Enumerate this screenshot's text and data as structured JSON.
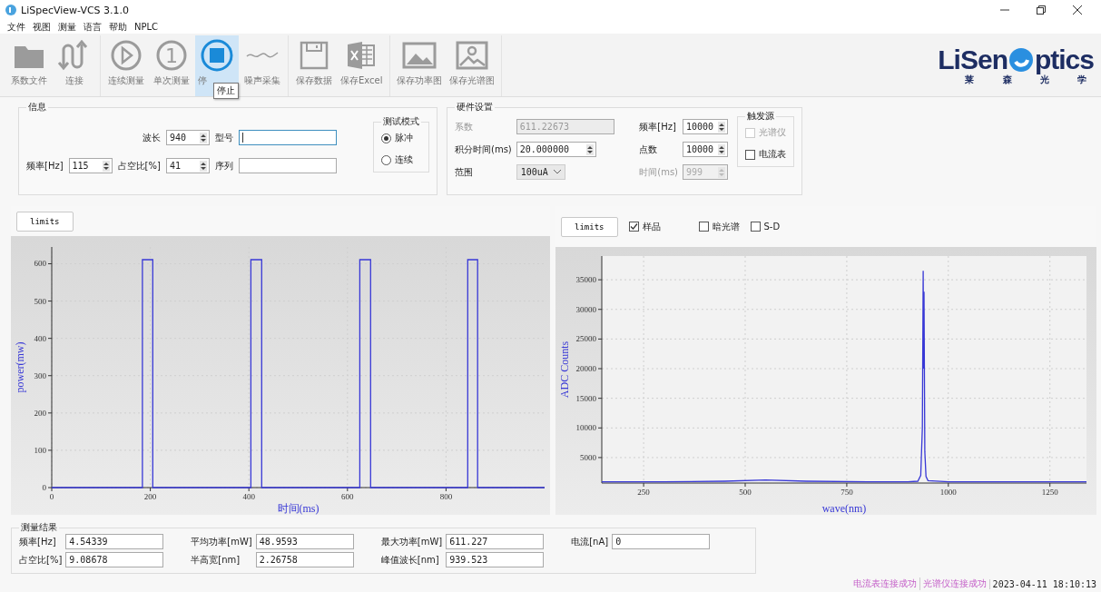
{
  "window": {
    "title": "LiSpecView-VCS 3.1.0"
  },
  "menu": [
    "文件",
    "视图",
    "测量",
    "语言",
    "帮助",
    "NPLC"
  ],
  "toolbar": {
    "groups": [
      [
        {
          "kind": "folder",
          "label": "系数文件",
          "selected": false
        },
        {
          "kind": "loop",
          "label": "连接",
          "selected": false
        }
      ],
      [
        {
          "kind": "play",
          "label": "连续测量",
          "selected": false
        },
        {
          "kind": "one",
          "glyph": "1",
          "label": "单次测量",
          "selected": false
        },
        {
          "kind": "stop",
          "label": "停",
          "selected": true,
          "tooltip": "停止"
        },
        {
          "kind": "wave",
          "label": "噪声采集",
          "selected": false
        }
      ],
      [
        {
          "kind": "save",
          "label": "保存数据",
          "selected": false
        },
        {
          "kind": "excel",
          "label": "保存Excel",
          "selected": false
        }
      ],
      [
        {
          "kind": "image",
          "label": "保存功率图",
          "selected": false
        },
        {
          "kind": "photo",
          "label": "保存光谱图",
          "selected": false
        }
      ]
    ]
  },
  "logo": {
    "left": "LiSen",
    "right": "ptics",
    "subtitle": [
      "莱",
      "森",
      "光",
      "学"
    ]
  },
  "info": {
    "title": "信息",
    "rows": [
      [
        "",
        {
          "kind": "spin",
          "label": "波长",
          "value": "940"
        },
        {
          "kind": "field",
          "label": "型号",
          "focused": true
        }
      ],
      [
        {
          "kind": "spin",
          "label": "频率[Hz]",
          "value": "115"
        },
        {
          "kind": "spin",
          "label": "占空比[%]",
          "value": "41"
        },
        {
          "kind": "field",
          "label": "序列",
          "focused": false
        }
      ]
    ],
    "mode": {
      "title": "测试模式",
      "options": [
        {
          "label": "脉冲",
          "selected": true
        },
        {
          "label": "连续",
          "selected": false
        }
      ]
    }
  },
  "hardware": {
    "title": "硬件设置",
    "left": [
      {
        "kind": "text",
        "label": "系数",
        "value": "611.22673",
        "disabled": true
      },
      {
        "kind": "spin",
        "label": "积分时间(ms)",
        "value": "20.000000",
        "disabled": false
      },
      {
        "kind": "combo",
        "label": "范围",
        "value": "100uA",
        "disabled": false
      }
    ],
    "right": [
      {
        "kind": "spin",
        "label": "频率[Hz]",
        "value": "10000",
        "disabled": false
      },
      {
        "kind": "spin",
        "label": "点数",
        "value": "10000",
        "disabled": false
      },
      {
        "kind": "spin",
        "label": "时间(ms)",
        "value": "999",
        "disabled": true
      }
    ],
    "trigger": {
      "title": "触发源",
      "options": [
        {
          "label": "光谱仪",
          "checked": false,
          "disabled": true
        },
        {
          "label": "电流表",
          "checked": false,
          "disabled": false
        }
      ]
    }
  },
  "power_chart": {
    "button": "limits",
    "chart_data": {
      "type": "line",
      "grid": true,
      "xlabel": "时间(ms)",
      "ylabel": "power(mw)",
      "xlim": [
        0,
        1000
      ],
      "ylim": [
        0,
        645
      ],
      "xticks": [
        0,
        200,
        400,
        600,
        800
      ],
      "yticks": [
        0,
        100,
        200,
        300,
        400,
        500,
        600
      ],
      "x": [
        0,
        184,
        184,
        205,
        205,
        404,
        404,
        426,
        426,
        625,
        625,
        647,
        647,
        844,
        844,
        864,
        864,
        1000
      ],
      "series": [
        {
          "values": [
            0,
            0,
            611,
            611,
            0,
            0,
            611,
            611,
            0,
            0,
            611,
            611,
            0,
            0,
            611,
            611,
            0,
            0
          ]
        }
      ]
    }
  },
  "spectrum_chart": {
    "button": "limits",
    "checks": [
      {
        "label": "样品",
        "checked": true
      },
      {
        "label": "暗光谱",
        "checked": false
      },
      {
        "label": "S-D",
        "checked": false
      }
    ],
    "chart_data": {
      "type": "line",
      "grid": true,
      "xlabel": "wave(nm)",
      "ylabel": "ADC Counts",
      "xlim": [
        147,
        1340
      ],
      "ylim": [
        700,
        39000
      ],
      "xticks": [
        250,
        500,
        750,
        1000,
        1250
      ],
      "yticks": [
        5000,
        10000,
        15000,
        20000,
        25000,
        30000,
        35000
      ],
      "x": [
        147,
        300,
        450,
        550,
        650,
        800,
        900,
        925,
        932,
        936,
        938,
        939,
        940,
        942,
        945,
        950,
        1000,
        1340
      ],
      "series": [
        {
          "values": [
            900,
            900,
            1000,
            1200,
            1000,
            900,
            900,
            1000,
            2000,
            10000,
            36500,
            20000,
            33000,
            6000,
            1800,
            1100,
            900,
            900
          ]
        }
      ]
    }
  },
  "results": {
    "title": "测量结果",
    "columns": [
      [
        {
          "label": "频率[Hz]",
          "value": "4.54339"
        },
        {
          "label": "占空比[%]",
          "value": "9.08678"
        }
      ],
      [
        {
          "label": "平均功率[mW]",
          "value": "48.9593"
        },
        {
          "label": "半高宽[nm]",
          "value": "2.26758"
        }
      ],
      [
        {
          "label": "最大功率[mW]",
          "value": "611.227"
        },
        {
          "label": "峰值波长[nm]",
          "value": "939.523"
        }
      ],
      [
        {
          "label": "电流[nA]",
          "value": "0"
        }
      ]
    ]
  },
  "status_bar": [
    {
      "kind": "message",
      "text": "电流表连接成功"
    },
    {
      "kind": "message",
      "text": "光谱仪连接成功"
    },
    {
      "kind": "time",
      "text": "2023-04-11 18:10:13"
    }
  ]
}
